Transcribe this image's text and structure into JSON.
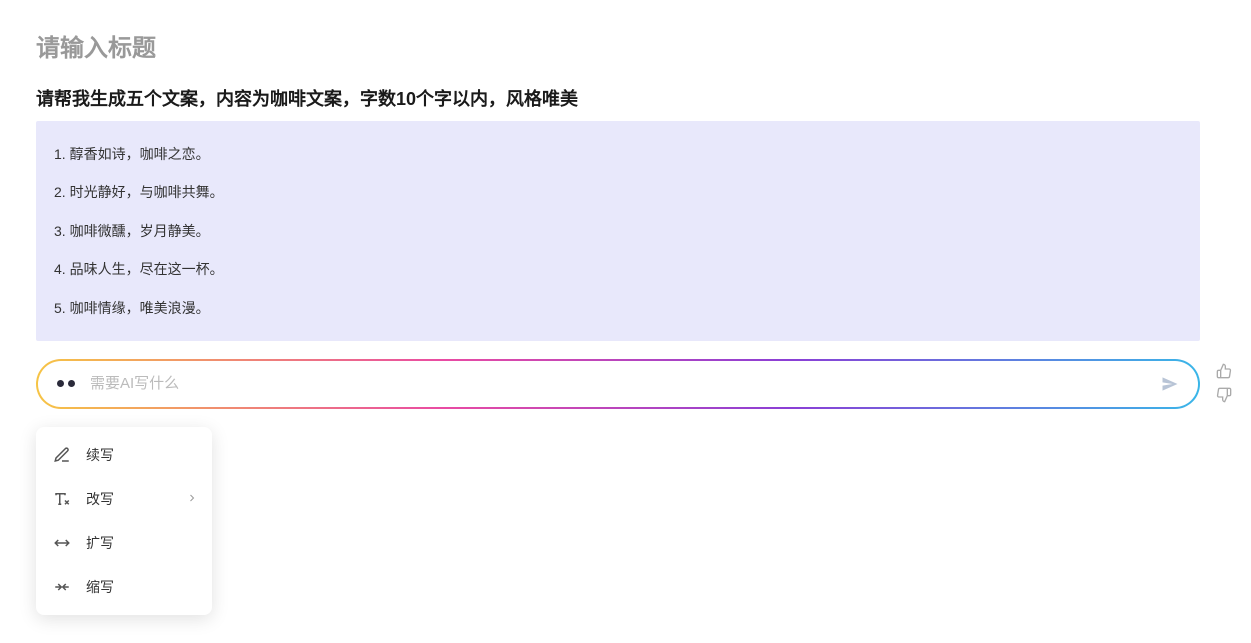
{
  "title_placeholder": "请输入标题",
  "prompt": "请帮我生成五个文案，内容为咖啡文案，字数10个字以内，风格唯美",
  "responses": [
    "1. 醇香如诗，咖啡之恋。",
    "2. 时光静好，与咖啡共舞。",
    "3. 咖啡微醺，岁月静美。",
    "4. 品味人生，尽在这一杯。",
    "5. 咖啡情缘，唯美浪漫。"
  ],
  "input": {
    "placeholder": "需要AI写什么"
  },
  "menu": {
    "items": [
      {
        "label": "续写",
        "icon": "pen-edit-icon",
        "has_submenu": false
      },
      {
        "label": "改写",
        "icon": "text-x-icon",
        "has_submenu": true
      },
      {
        "label": "扩写",
        "icon": "expand-icon",
        "has_submenu": false
      },
      {
        "label": "缩写",
        "icon": "compress-icon",
        "has_submenu": false
      }
    ]
  }
}
